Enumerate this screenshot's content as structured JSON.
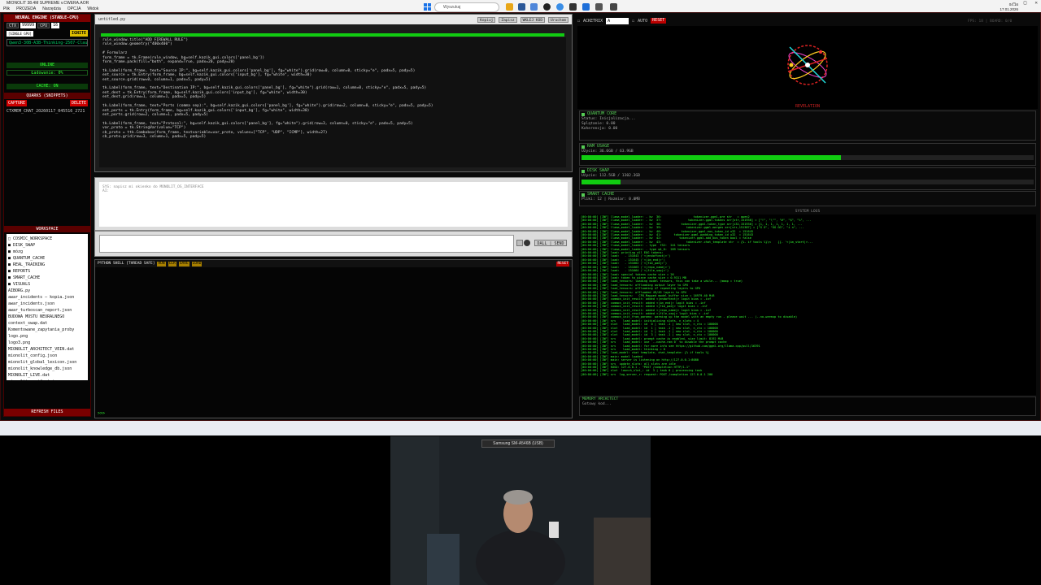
{
  "window": {
    "title": "MIONOLIT 38.4M SUPREME v.CWERA.AOR",
    "menu": [
      "Plik",
      "PROZEDA",
      "Narzędzia",
      "OPCJA",
      "Widok"
    ]
  },
  "left_panel": {
    "header": "NEURAL ENGINE (STABLE-CPU)",
    "ctx_label": "CTX",
    "ctx_value": "99999",
    "cpu_label": "CPU",
    "cpu_value": "16",
    "mode_badge": "[SINGLE GPU]",
    "ignite_label": "IGNITE",
    "model_name": "Qwen3-30B-A3B-Thinking-2507-Claude-4.5-Sonnet",
    "online_status": "ONLINE",
    "loading_status": "Ładowanie: 0%",
    "cache_status": "CACHE: ON",
    "quarks_header": "QUARKS (SNIPPETS)",
    "capture_label": "CAPTURE",
    "delete_label": "DELETE",
    "memory_item": "CTXMEM_CHAT_20260117_045516_2721",
    "workspace_header": "WORKSPACE",
    "tree": [
      "□ COSMIC_WORKSPACE",
      "  ■ DISK_SWAP",
      "  ■ mózg",
      "  ■ QUANTUM_CACHE",
      "  ■ REAL_TRAINING",
      "  ■ REPORTS",
      "  ■ SMART_CACHE",
      "  ■ VISUALS",
      "    AIBORG.py",
      "    awar_incidents — kopia.json",
      "    awar_incidents.json",
      "    awar_turboscan_report.json",
      "    BUDOWA MOSTU NEURALNEGO",
      "    context_swap.dat",
      "    Komentowane_zapytania_proby",
      "    logo.png",
      "    logo3.png",
      "    MIONOLIT_ARCHITECT_VEIN.dat",
      "    mionolit_config.json",
      "    mionolit_global_lexicon.json",
      "    mionolit_knowledge_db.json",
      "    MIONOLIT_LIVE.dat",
      "    mionolit_manifest.json",
      "    mionolit_profiles.json"
    ],
    "refresh_label": "REFRESH FILES"
  },
  "editor": {
    "filename": "untitled.py",
    "buttons": [
      "Kopiuj",
      "Zapisz",
      "WKLEJ KOD",
      "Uruchom"
    ],
    "code": [
      "rule_window.title(\"ADD FIREWALL RULE\")",
      "rule_window.geometry(\"400x400\")",
      "",
      "# Formularz",
      "form_frame = tk.Frame(rule_window, bg=self.kazik_gui.colors['panel_bg'])",
      "form_frame.pack(fill=\"both\", expand=True, padx=20, pady=20)",
      "",
      "tk.Label(form_frame, text=\"Source IP:\", bg=self.kazik_gui.colors['panel_bg'], fg=\"white\").grid(row=0, column=0, sticky=\"e\", padx=5, pady=5)",
      "ent_source = tk.Entry(form_frame, bg=self.kazik_gui.colors['input_bg'], fg=\"white\", width=30)",
      "ent_source.grid(row=0, column=1, padx=5, pady=5)",
      "",
      "tk.Label(form_frame, text=\"Destination IP:\", bg=self.kazik_gui.colors['panel_bg'], fg=\"white\").grid(row=1, column=0, sticky=\"e\", padx=5, pady=5)",
      "ent_dest = tk.Entry(form_frame, bg=self.kazik_gui.colors['input_bg'], fg=\"white\", width=30)",
      "ent_dest.grid(row=1, column=1, padx=5, pady=5)",
      "",
      "tk.Label(form_frame, text=\"Ports (comma sep):\", bg=self.kazik_gui.colors['panel_bg'], fg=\"white\").grid(row=2, column=0, sticky=\"e\", padx=5, pady=5)",
      "ent_ports = tk.Entry(form_frame, bg=self.kazik_gui.colors['input_bg'], fg=\"white\", width=30)",
      "ent_ports.grid(row=2, column=1, padx=5, pady=5)",
      "",
      "tk.Label(form_frame, text=\"Protocol:\", bg=self.kazik_gui.colors['panel_bg'], fg=\"white\").grid(row=3, column=0, sticky=\"e\", padx=5, pady=5)",
      "var_proto = tk.StringVar(value=\"TCP\")",
      "cb_proto = ttk.Combobox(form_frame, textvariable=var_proto, values=[\"TCP\", \"UDP\", \"ICMP\"], width=27)",
      "cb_proto.grid(row=3, column=1, padx=5, pady=5)"
    ]
  },
  "output": {
    "text": "SYS: napisz mi okienko do MONOLIT_OS_INTERFACE\nAI:"
  },
  "input": {
    "send_label": "SEND",
    "dalle_label": "DALL"
  },
  "shell": {
    "title": "PYTHON SHELL [THREAD SAFE]",
    "buttons": [
      "RUN",
      "CLR",
      "SAVE",
      "LOAD"
    ],
    "reset_label": "RESET",
    "prompt": ">>>"
  },
  "right_toolbar": {
    "matrix_label": "ACKETRIX",
    "matrix_value": "A",
    "auto_label": "AUTO",
    "reset_label": "RESET",
    "fps_info": "FPS: 18 | BOARD: 0/0"
  },
  "visual": {
    "caption": "REVELATION"
  },
  "stats": {
    "quantum_title": "QUANTUM CORE",
    "quantum_lines": [
      "Status: Inicjalizacja...",
      "Splątanie: 0.00",
      "Koherencja: 0.00"
    ],
    "ram_title": "RAM USAGE",
    "ram_line": "Użycie: 36.6GB / 63.9GB",
    "ram_fraction": 0.573,
    "swap_title": "DISK SWAP",
    "swap_line": "Użycie: 112.5GB / 1302.3GB",
    "swap_fraction": 0.086,
    "smart_title": "SMART CACHE",
    "smart_line": "Pliki: 12 | Rozmiar: 0.0MB"
  },
  "syslog": {
    "title": "SYSTEM LOGS",
    "lines": [
      "[00:00:00] [INF] llama_model_loader: - kv  36:                  tokenizer.ggml.pre str   = qwen2",
      "[00:00:00] [INF] llama_model_loader: - kv  37:               tokenizer.ggml.tokens arr[str,151936] = [\"!\", \"\\\"\", \"#\", \"$\", \"%\", ...",
      "[00:00:00] [INF] llama_model_loader: - kv  38:           tokenizer.ggml.token_type arr[i32,151936] = [1, 1, 1, 1, 1, 1, 1, ...",
      "[00:00:00] [INF] llama_model_loader: - kv  39:              tokenizer.ggml.merges arr[str,151387] = [\"Ġ Ġ\", \"ĠĠ ĠĠ\", \"i n\", ...",
      "[00:00:00] [INF] llama_model_loader: - kv  40:           tokenizer.ggml.eos_token_id u32  = 151645",
      "[00:00:00] [INF] llama_model_loader: - kv  41:       tokenizer.ggml.padding_token_id u32  = 151643",
      "[00:00:00] [INF] llama_model_loader: - kv  42:          tokenizer.ggml.add_bos_token bool = false",
      "[00:00:00] [INF] llama_model_loader: - kv  43:              tokenizer.chat_template str  = {%- if tools %}\\n    {{- '<|im_start|>...",
      "[00:00:00] [INF] llama_model_loader: - type  f32:  241 tensors",
      "[00:00:00] [INF] llama_model_loader: - type q4_K:  289 tensors",
      "[00:00:00] [INF] load: printing all EOG tokens:",
      "[00:00:00] [INF] load:   - 151643 ('<|endoftext|>')",
      "[00:00:00] [INF] load:   - 151645 ('<|im_end|>')",
      "[00:00:00] [INF] load:   - 151662 ('<|fim_pad|>')",
      "[00:00:00] [INF] load:   - 151663 ('<|repo_name|>')",
      "[00:00:00] [INF] load:   - 151664 ('<|file_sep|>')",
      "[00:00:00] [INF] load: special tokens cache size = 26",
      "[00:00:00] [INF] load: token to piece cache size = 0.9311 MB",
      "[00:00:00] [INF] load_tensors: loading model tensors, this can take a while... (mmap = true)",
      "[00:00:00] [INF] load_tensors: offloading output layer to GPU",
      "[00:00:00] [INF] load_tensors: offloading 47 repeating layers to GPU",
      "[00:00:00] [INF] load_tensors: offloaded 49/49 layers to GPU",
      "[00:00:00] [INF] load_tensors:   CPU_Mapped model buffer size = 16979.40 MiB",
      "[00:00:00] [INF] common_init_result: added <|endoftext|> logit bias = -inf",
      "[00:00:00] [INF] common_init_result: added <|im_end|> logit bias = -inf",
      "[00:00:00] [INF] common_init_result: added <|fim_pad|> logit bias = -inf",
      "[00:00:00] [INF] common_init_result: added <|repo_name|> logit bias = -inf",
      "[00:00:00] [INF] common_init_result: added <|file_sep|> logit bias = -inf",
      "[00:00:00] [INF] common_init_from_params: warming up the model with an empty run - please wait ... (--no-warmup to disable)",
      "[00:00:00] [INF] srv    load_model: initializing slots, n_slots = 4",
      "[00:00:00] [INF] slot   load_model: id  0 | task -1 | new slot, n_ctx = 100000",
      "[00:00:00] [INF] slot   load_model: id  1 | task -1 | new slot, n_ctx = 100000",
      "[00:00:00] [INF] slot   load_model: id  2 | task -1 | new slot, n_ctx = 100000",
      "[00:00:00] [INF] slot   load_model: id  3 | task -1 | new slot, n_ctx = 100000",
      "[00:00:00] [INF] srv    load_model: prompt cache is enabled, size limit: 8192 MiB",
      "[00:00:00] [INF] srv    load_model: use `--cache-ram 0` to disable the prompt cache",
      "[00:00:00] [INF] srv    load_model: for more info see https://github.com/ggml-org/llama.cpp/pull/16391",
      "[00:00:00] [INF] srv    load_model: thinking = 0",
      "[00:00:00] [INF] load_model: chat template, chat_template: {% if tools %}",
      "[00:00:00] [INF] main: model loaded",
      "[00:00:00] [INF] main: server is listening on http://127.0.0.1:8080",
      "[00:00:00] [INF] srv  update_slots: all slots are idle",
      "[00:00:00] [INF] KOGO: 127.0.0.1 - \"POST /completion HTTP/1.1\"",
      "[00:00:00] [INF] slot  launch_slot_: id  3 | task 0 | processing task",
      "[00:00:00] [INF] srv  log_server_r: request: POST /completion 127.0.0.1 200"
    ]
  },
  "memory_architect": {
    "title": "MEMORY ARCHITECT",
    "input_text": "Gotowy kod..."
  },
  "taskbar": {
    "search_placeholder": "Wyszukaj",
    "time": "04:16",
    "date": "17.01.2026"
  },
  "webcam": {
    "device_label": "Samsung SM-A546B (USB)"
  }
}
